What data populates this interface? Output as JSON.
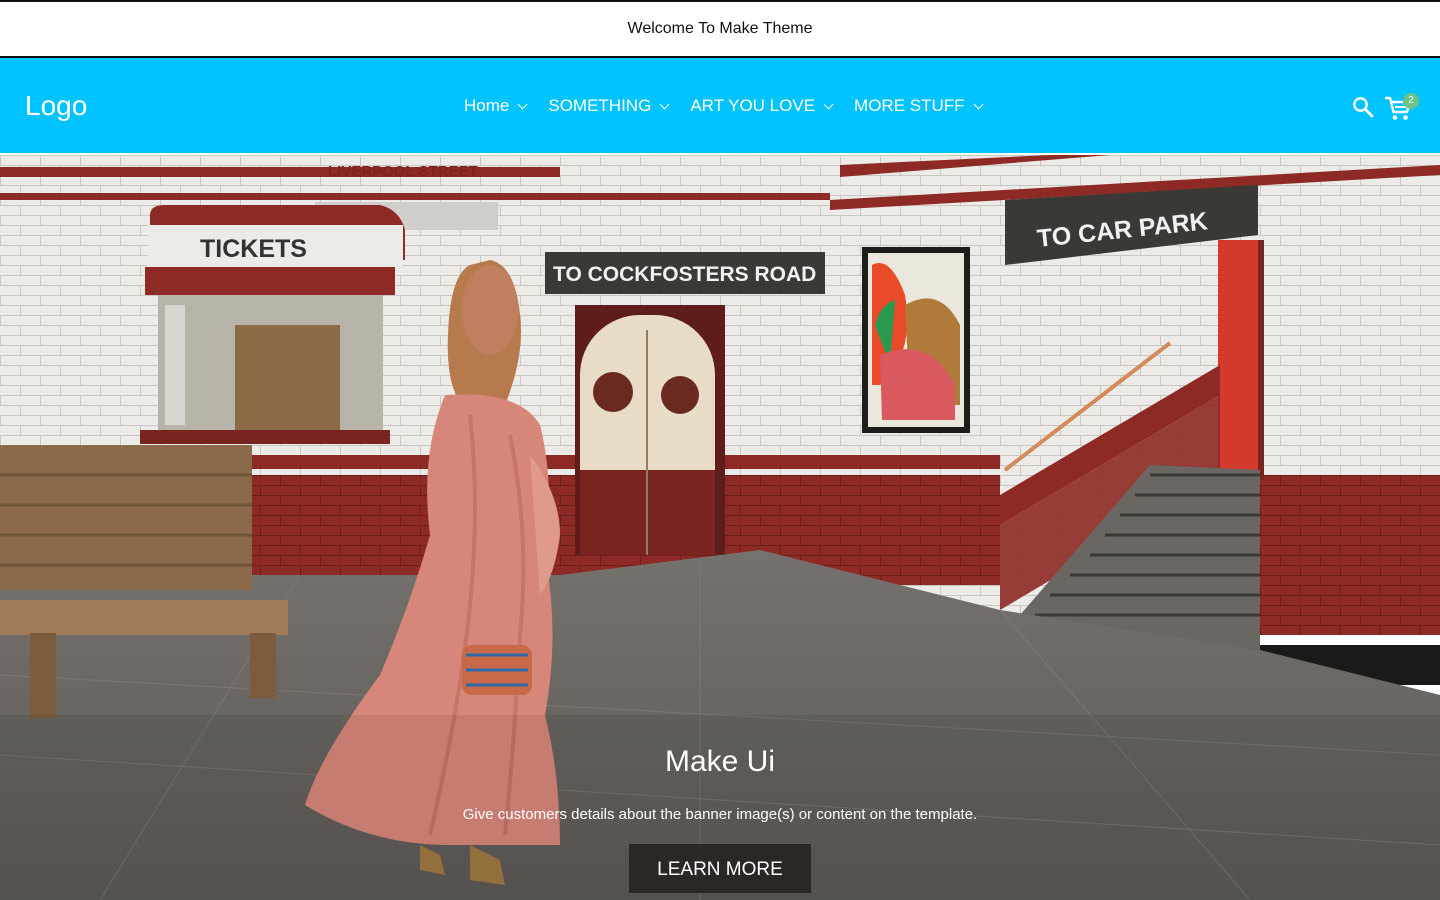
{
  "announcement": {
    "text": "Welcome To Make Theme"
  },
  "header": {
    "logo": "Logo",
    "nav": [
      {
        "label": "Home",
        "icon": "chevron-down-icon"
      },
      {
        "label": "SOMETHING",
        "icon": "chevron-down-icon"
      },
      {
        "label": "ART YOU LOVE",
        "icon": "chevron-down-icon"
      },
      {
        "label": "MORE STUFF",
        "icon": "chevron-down-icon"
      }
    ],
    "search_icon": "search-icon",
    "cart_icon": "cart-icon",
    "cart_count": "2",
    "background_color": "#00c3ff",
    "badge_color": "#6cc484"
  },
  "hero": {
    "sign_station": "LIVERPOOL STREET",
    "sign_tickets": "TICKETS",
    "sign_road": "TO COCKFOSTERS ROAD",
    "sign_car_park": "TO CAR PARK",
    "title": "Make Ui",
    "subtitle": "Give customers details about the banner image(s) or content on the template.",
    "cta_label": "LEARN MORE"
  }
}
